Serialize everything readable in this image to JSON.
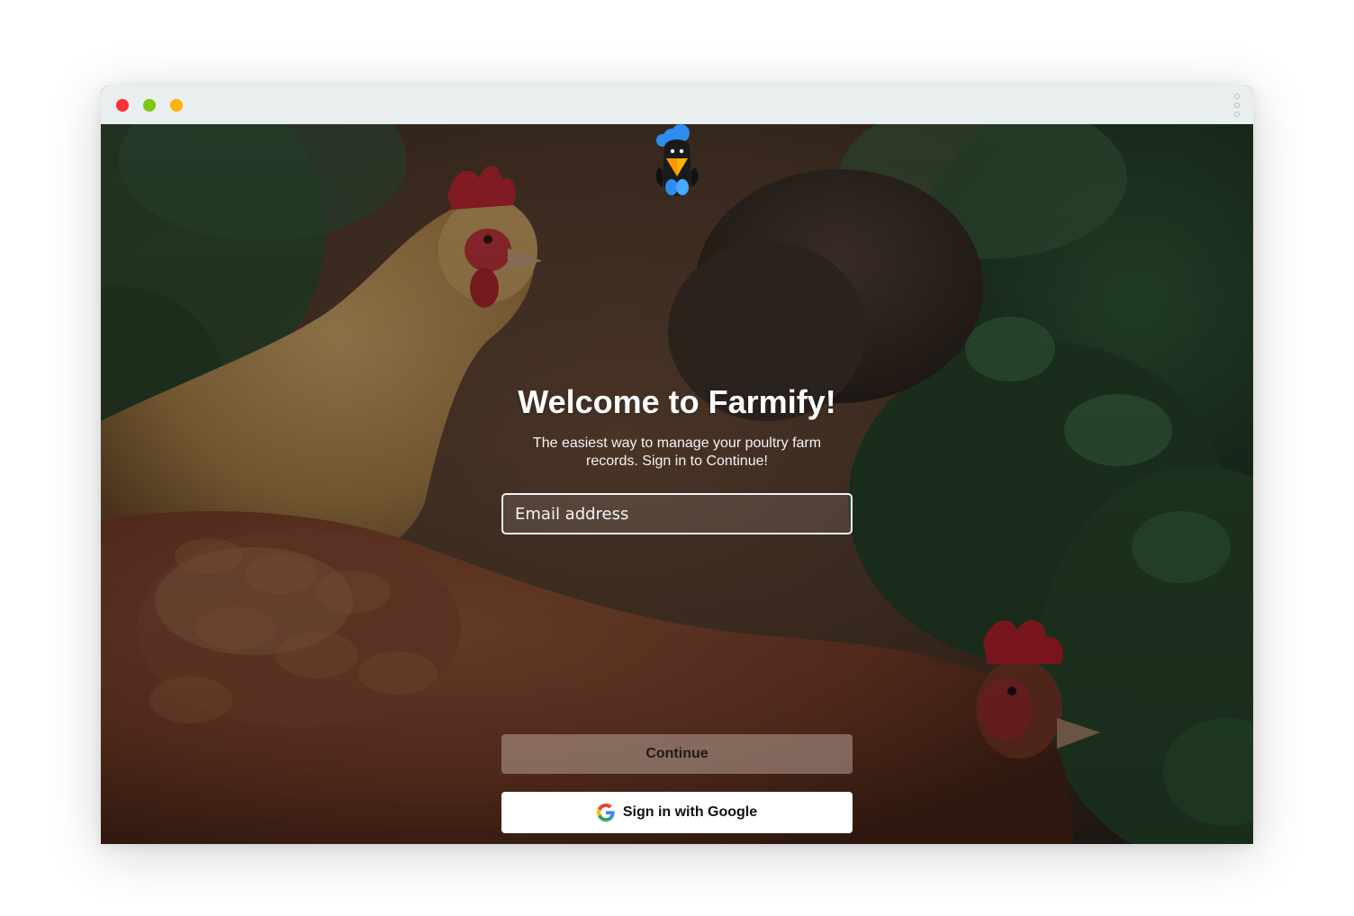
{
  "window": {
    "controls": {
      "close_color": "#ff2f3b",
      "minimize_color": "#79c70f",
      "zoom_color": "#ffb400"
    },
    "menu_icon": "kebab-vertical-icon"
  },
  "app": {
    "logo_icon": "rooster-logo-icon",
    "background_image": "chickens-photo"
  },
  "login": {
    "title": "Welcome to Farmify!",
    "subtitle": "The easiest way to manage your poultry farm records. Sign in to Continue!",
    "email": {
      "value": "",
      "placeholder": "Email address"
    },
    "continue_label": "Continue",
    "google_label": "Sign in with Google",
    "google_icon": "google-g-icon"
  },
  "colors": {
    "overlay": "#1d1714",
    "button_white": "#ffffff",
    "continue_bg": "#8f7f76"
  }
}
